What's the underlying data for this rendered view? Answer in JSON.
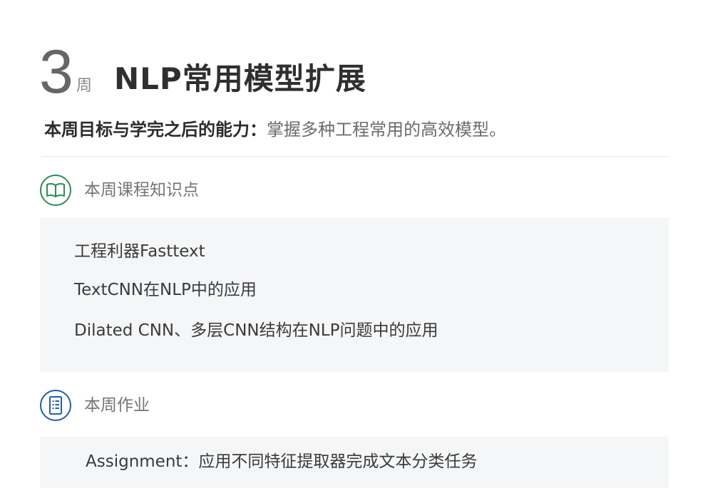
{
  "header": {
    "week_number": "3",
    "week_unit": "周",
    "title": "NLP常用模型扩展"
  },
  "goal": {
    "label": "本周目标与学完之后的能力：",
    "text": "掌握多种工程常用的高效模型。"
  },
  "knowledge_section": {
    "icon": "book-icon",
    "label": "本周课程知识点",
    "accent_color": "#2e8b57",
    "items": [
      "工程利器Fasttext",
      "TextCNN在NLP中的应用",
      "Dilated CNN、多层CNN结构在NLP问题中的应用"
    ]
  },
  "homework_section": {
    "icon": "document-list-icon",
    "label": "本周作业",
    "accent_color": "#1e5fa8",
    "assignment": "Assignment：应用不同特征提取器完成文本分类任务"
  }
}
